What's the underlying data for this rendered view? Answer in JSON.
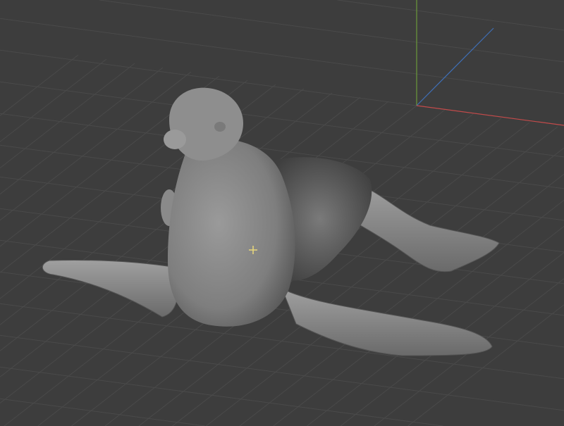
{
  "viewport": {
    "mode": "3d-viewport",
    "object": "sea-lion-sculpt",
    "colors": {
      "background": "#3d3d3d",
      "grid": "#4a4a4a",
      "axis_x": "#c24a4a",
      "axis_y": "#6a9a3a",
      "axis_z": "#3f6fb5",
      "cursor": "#e8d77a",
      "mesh": "#8a8a8a"
    },
    "icons": [
      "3d-cursor-icon"
    ]
  }
}
